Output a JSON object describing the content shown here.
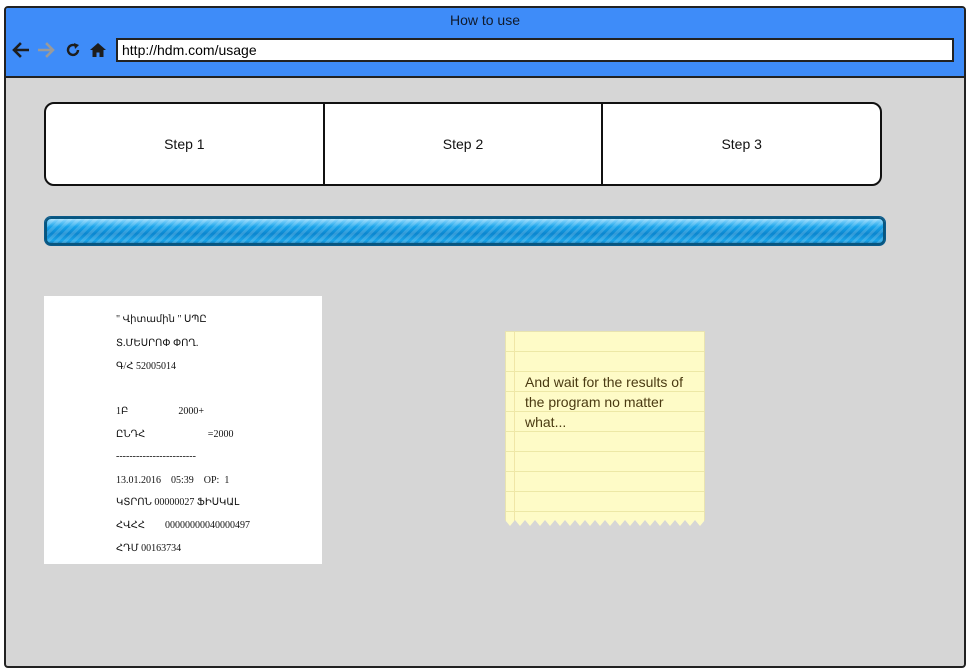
{
  "window": {
    "title": "How to use"
  },
  "nav": {
    "back_icon": "arrow-left-icon",
    "forward_icon": "arrow-right-icon",
    "reload_icon": "reload-icon",
    "home_icon": "home-icon"
  },
  "address_bar": {
    "url": "http://hdm.com/usage"
  },
  "steps": [
    {
      "label": "Step 1"
    },
    {
      "label": "Step 2"
    },
    {
      "label": "Step 3"
    }
  ],
  "progress": {
    "value": 1.0
  },
  "receipt": {
    "lines": [
      "\" Վիտամին \" ՍՊԸ",
      "Տ.ՄԵՍՐՈՓ ՓՈՂ.",
      "Գ/Հ 52005014",
      "1Բ                    2000+",
      "ԸՆԴՀ                         =2000",
      "------------------------",
      "13.01.2016    05:39    OP:  1",
      "ԿՏՐՈՆ 00000027 ՖԻՍԿԱԼ",
      "ՀՎՀՀ        00000000040000497",
      "ՀԴՄ 00163734"
    ]
  },
  "note": {
    "text": "And wait for the results of the program no matter what..."
  },
  "colors": {
    "titlebar": "#3e8cf9",
    "canvas": "#d6d6d6",
    "note": "#fefbc7",
    "progress": "#1aa5ea"
  }
}
